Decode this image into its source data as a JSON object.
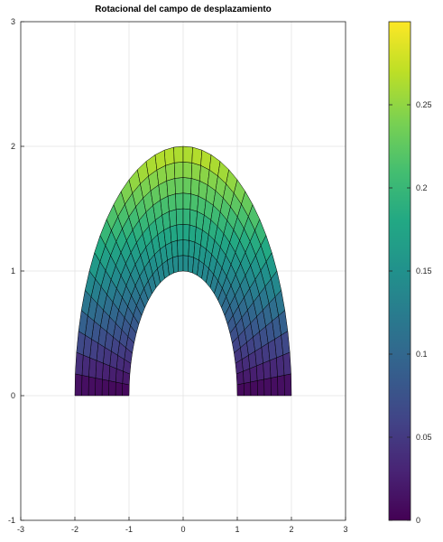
{
  "chart_data": {
    "type": "heatmap",
    "title": "Rotacional del campo de desplazamiento",
    "xlabel": "",
    "ylabel": "",
    "xlim": [
      -3,
      3
    ],
    "ylim": [
      -1,
      3
    ],
    "x_ticks": [
      "-3",
      "-2",
      "-1",
      "0",
      "1",
      "2",
      "3"
    ],
    "y_ticks": [
      "-1",
      "0",
      "1",
      "2",
      "3"
    ],
    "grid": true,
    "mesh": {
      "shape": "half-ellipse arch",
      "outer_semi_axes": {
        "a": 2,
        "b": 2
      },
      "inner_semi_axes": {
        "a": 1,
        "b": 1
      },
      "angular_divisions": 36,
      "radial_divisions": 8,
      "field_min_at": "base of arch",
      "field_max_at": "crown of outer edge"
    },
    "colorbar": {
      "colormap": "viridis",
      "range": [
        0,
        0.3
      ],
      "ticks": [
        "0",
        "0.05",
        "0.1",
        "0.15",
        "0.2",
        "0.25"
      ]
    }
  }
}
